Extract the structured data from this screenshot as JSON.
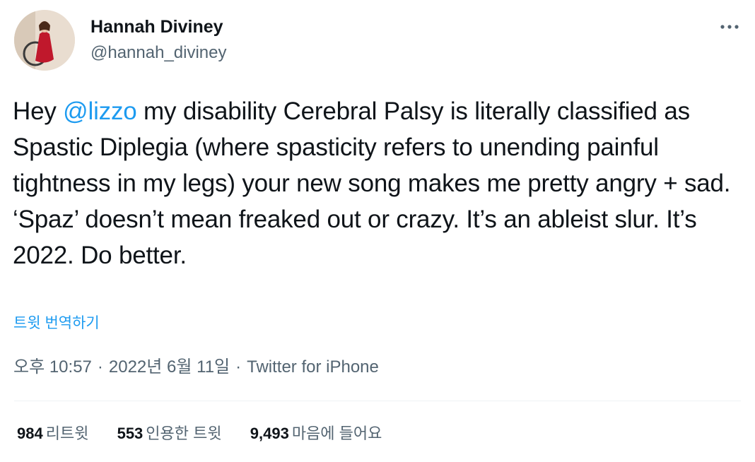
{
  "author": {
    "display_name": "Hannah Diviney",
    "handle": "@hannah_diviney"
  },
  "tweet": {
    "text_before": "Hey ",
    "mention": "@lizzo",
    "text_after": " my disability Cerebral Palsy is literally classified as Spastic Diplegia (where spasticity refers to unending painful tightness in my legs) your new song makes me pretty angry + sad. ‘Spaz’ doesn’t mean freaked out or crazy. It’s an ableist slur. It’s 2022. Do better.",
    "translate_label": "트윗 번역하기",
    "time": "오후 10:57",
    "date": "2022년 6월 11일",
    "separator": "·",
    "source": "Twitter for iPhone"
  },
  "stats": {
    "retweets_count": "984",
    "retweets_label": "리트윗",
    "quotes_count": "553",
    "quotes_label": "인용한 트윗",
    "likes_count": "9,493",
    "likes_label": "마음에 들어요"
  },
  "icons": {
    "more": "more-horizontal-icon"
  },
  "colors": {
    "text_primary": "#0f1419",
    "text_secondary": "#536471",
    "link": "#1d9bf0",
    "divider": "#eff3f4"
  }
}
